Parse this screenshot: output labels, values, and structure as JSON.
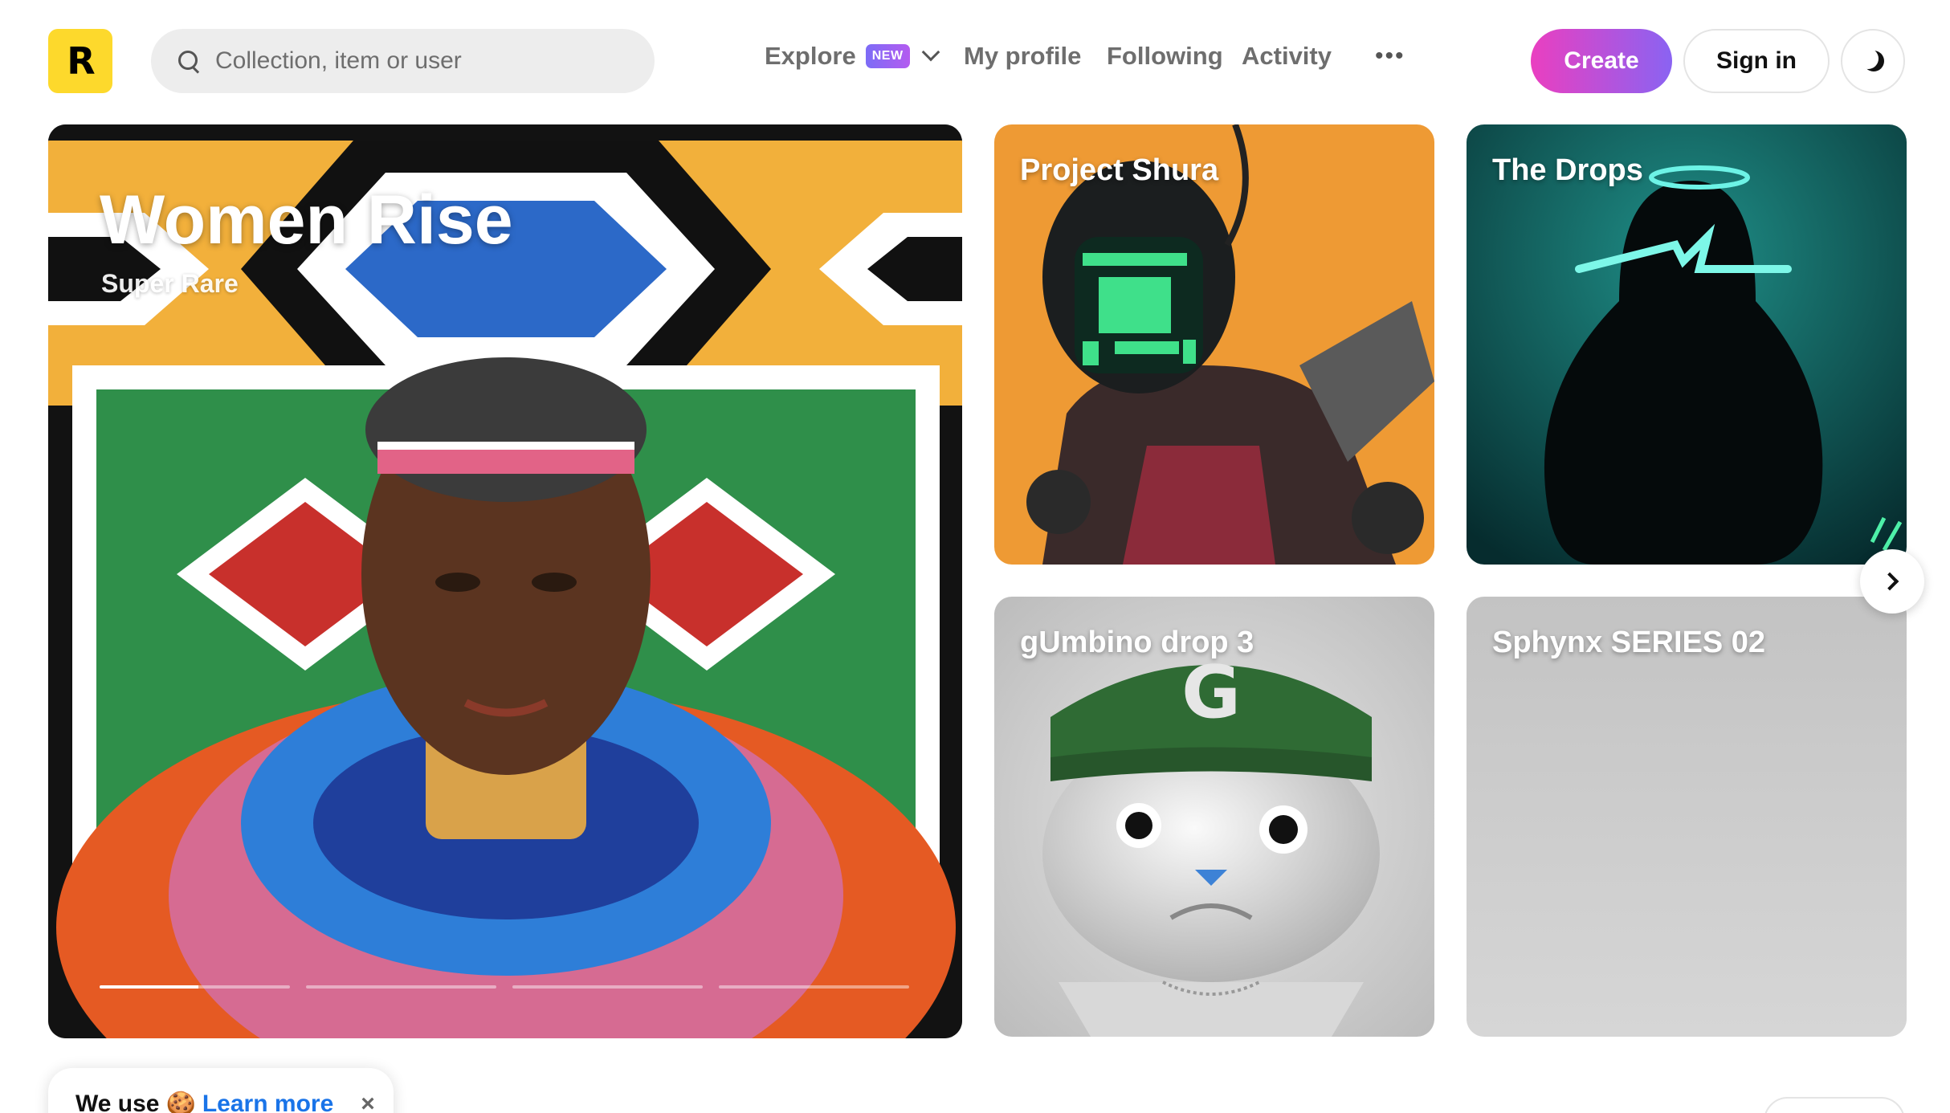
{
  "header": {
    "logo_letter": "R",
    "search": {
      "placeholder": "Collection, item or user"
    },
    "nav": {
      "explore": "Explore",
      "explore_badge": "NEW",
      "my_profile": "My profile",
      "following": "Following",
      "activity": "Activity",
      "more_label": "•••"
    },
    "create_label": "Create",
    "sign_in_label": "Sign in",
    "theme_icon": "moon-icon"
  },
  "hero": {
    "title": "Women Rise",
    "subtitle": "Super Rare",
    "slides_total": 4,
    "active_slide": 1,
    "active_progress": 0.52
  },
  "cards": [
    {
      "title": "Project Shura"
    },
    {
      "title": "The Drops"
    },
    {
      "title": "gUmbino drop 3"
    },
    {
      "title": "Sphynx SERIES 02"
    }
  ],
  "cookie": {
    "text": "We use",
    "emoji": "🍪",
    "link": "Learn more",
    "close": "×"
  },
  "colors": {
    "logo_yellow": "#fdd92c",
    "create_gradient_start": "#ea3fc0",
    "create_gradient_end": "#8a63f2",
    "link_blue": "#1a74e8"
  }
}
